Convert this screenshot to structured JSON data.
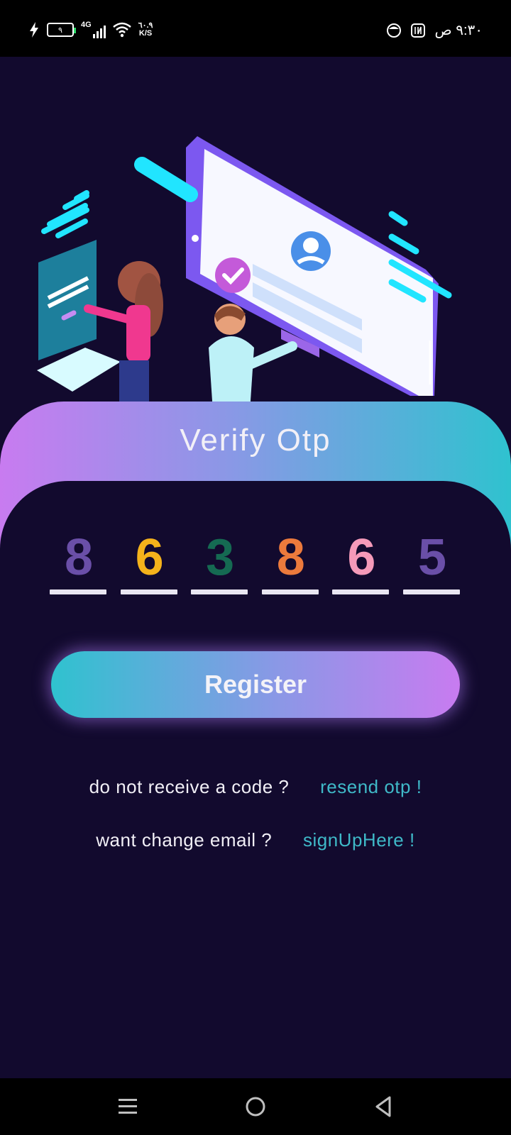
{
  "status_bar": {
    "battery_level": "٩",
    "network": "4G",
    "data_speed_value": "٦٠.٩",
    "data_speed_unit": "K/S",
    "time": "٩:٣٠ ص"
  },
  "card": {
    "title": "Verify Otp"
  },
  "otp": {
    "digits": [
      {
        "value": "8",
        "color": "#6a4fa8"
      },
      {
        "value": "6",
        "color": "#f4b21b"
      },
      {
        "value": "3",
        "color": "#156a52"
      },
      {
        "value": "8",
        "color": "#ec7a3c"
      },
      {
        "value": "6",
        "color": "#f59ab9"
      },
      {
        "value": "5",
        "color": "#6a4fa8"
      }
    ]
  },
  "register_button": {
    "label": "Register"
  },
  "resend": {
    "prompt": "do not receive a code ?",
    "link": "resend otp !"
  },
  "change_email": {
    "prompt": "want change email ?",
    "link": "signUpHere !"
  },
  "colors": {
    "background": "#120a2e",
    "gradient_start": "#c87bf0",
    "gradient_end": "#2fc2cf",
    "link": "#3fb9c8"
  },
  "icons": {
    "status_left": [
      "charging-icon",
      "battery-icon",
      "signal-icon",
      "wifi-icon"
    ],
    "status_right": [
      "app-notification-icon",
      "nfc-icon"
    ],
    "nav": [
      "menu-icon",
      "home-icon",
      "back-icon"
    ]
  }
}
